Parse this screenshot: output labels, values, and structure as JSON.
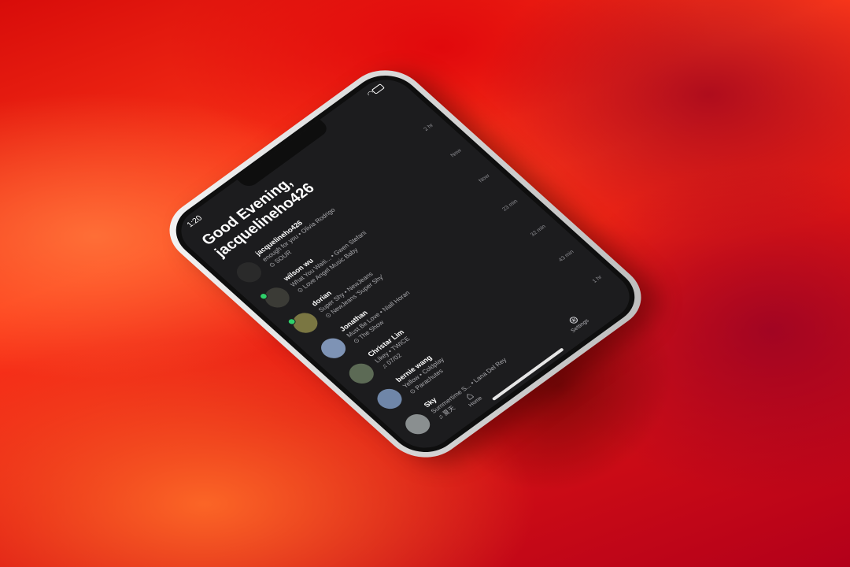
{
  "status": {
    "time": "1:20"
  },
  "header": {
    "greeting_line1": "Good Evening,",
    "greeting_line2": "jacquelineho426"
  },
  "feed": [
    {
      "name": "jacquelineho426",
      "track": "enough for you • Olivia Rodrigo",
      "context": "⊙ SOUR",
      "ago": "2 hr",
      "online": false,
      "avatar_color": "#2a2a2a"
    },
    {
      "name": "wilson wu",
      "track": "What You Waiti... • Gwen Stefani",
      "context": "⊙ Love Angel Music Baby",
      "ago": "Now",
      "online": true,
      "avatar_color": "#3b3b36"
    },
    {
      "name": "dorian",
      "track": "Super Shy • NewJeans",
      "context": "⊙ NewJeans 'Super Shy'",
      "ago": "Now",
      "online": true,
      "avatar_color": "#7a7642"
    },
    {
      "name": "Jonathan",
      "track": "Must Be Love • Niall Horan",
      "context": "⊙ The Show",
      "ago": "23 min",
      "online": false,
      "avatar_color": "#7e93b5"
    },
    {
      "name": "Christar Lim",
      "track": "Likey • TWICE",
      "context": "♫ 07/02",
      "ago": "32 min",
      "online": false,
      "avatar_color": "#5c6a55"
    },
    {
      "name": "bernie wang",
      "track": "Yellow • Coldplay",
      "context": "⊙ Parachutes",
      "ago": "43 min",
      "online": false,
      "avatar_color": "#6f86a8"
    },
    {
      "name": "Sky",
      "track": "Summertime S... • Lana Del Rey",
      "context": "♫ 夏天",
      "ago": "1 hr",
      "online": false,
      "avatar_color": "#8a8f90"
    }
  ],
  "tabs": {
    "home": "Home",
    "settings": "Settings"
  },
  "icons": {
    "home": "home-icon",
    "settings": "settings-icon",
    "wifi": "wifi-icon",
    "battery": "battery-icon"
  },
  "colors": {
    "screen_bg": "#1c1c1e",
    "online": "#2fd06a",
    "background": "#e01512"
  }
}
